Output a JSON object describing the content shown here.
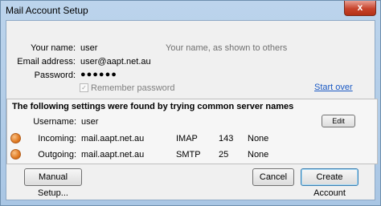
{
  "window": {
    "title": "Mail Account Setup",
    "close_label": "x"
  },
  "form": {
    "name_label": "Your name:",
    "name_value": "user",
    "name_hint": "Your name, as shown to others",
    "email_label": "Email address:",
    "email_value": "user@aapt.net.au",
    "password_label": "Password:",
    "password_value": "●●●●●●",
    "remember_label": "Remember password",
    "remember_checked": true,
    "start_over_label": "Start over"
  },
  "settings": {
    "title": "The following settings were found by trying common server names",
    "username_label": "Username:",
    "username_value": "user",
    "edit_label": "Edit",
    "incoming": {
      "label": "Incoming:",
      "server": "mail.aapt.net.au",
      "protocol": "IMAP",
      "port": "143",
      "security": "None"
    },
    "outgoing": {
      "label": "Outgoing:",
      "server": "mail.aapt.net.au",
      "protocol": "SMTP",
      "port": "25",
      "security": "None"
    },
    "status_color": "#e07a22"
  },
  "buttons": {
    "manual_setup": "Manual Setup...",
    "cancel": "Cancel",
    "create_account": "Create Account"
  }
}
